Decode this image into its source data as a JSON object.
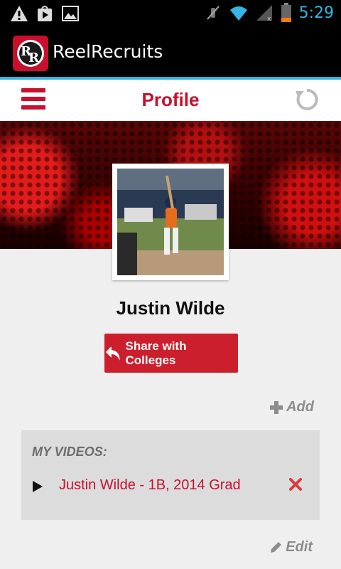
{
  "status_bar": {
    "time": "5:29",
    "left_icons": [
      "warning-icon",
      "play-store-icon",
      "gallery-icon"
    ],
    "right_icons": [
      "mute-icon",
      "wifi-icon",
      "signal-icon",
      "battery-icon"
    ]
  },
  "app": {
    "title": "ReelRecruits",
    "logo_text": "RR",
    "accent_color": "#33b5e5",
    "brand_color": "#c8102e"
  },
  "nav": {
    "title": "Profile",
    "menu_icon": "hamburger-icon",
    "refresh_icon": "refresh-icon"
  },
  "profile": {
    "name": "Justin Wilde",
    "share_button": "Share with Colleges",
    "add_label": "Add",
    "edit_label": "Edit"
  },
  "videos": {
    "heading": "MY VIDEOS:",
    "items": [
      {
        "title": "Justin Wilde - 1B, 2014 Grad"
      }
    ]
  }
}
